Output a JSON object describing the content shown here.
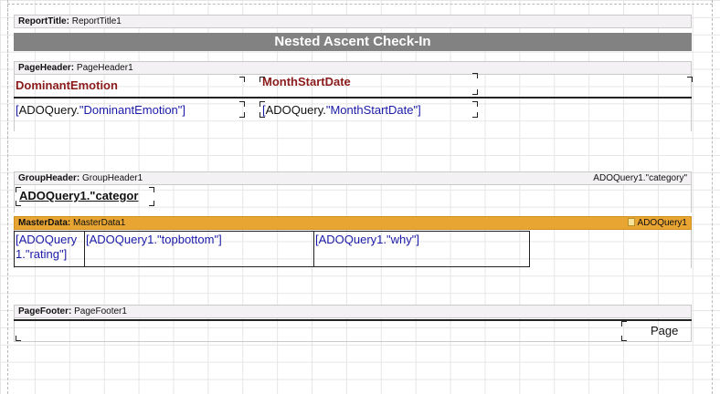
{
  "bands": {
    "report_title": {
      "kind": "ReportTitle:",
      "name": "ReportTitle1",
      "title": "Nested Ascent Check-In"
    },
    "page_header": {
      "kind": "PageHeader:",
      "name": "PageHeader1",
      "col1_label": "DominantEmotion",
      "col2_label": "MonthStartDate"
    },
    "page_header_fields": {
      "col1": {
        "query": "ADOQuery.",
        "field": "\"DominantEmotion\""
      },
      "col2": {
        "query": "ADOQuery.",
        "field": "\"MonthStartDate\""
      }
    },
    "group_header": {
      "kind": "GroupHeader:",
      "name": "GroupHeader1",
      "condition": "ADOQuery1.\"category\"",
      "field_text": "ADOQuery1.\"categor"
    },
    "master_data": {
      "kind": "MasterData:",
      "name": "MasterData1",
      "dataset": "ADOQuery1",
      "cells": [
        {
          "line1": "[ADOQuery",
          "line2": "1.\"rating\"]"
        },
        {
          "line1": "[ADOQuery1.\"topbottom\"]"
        },
        {
          "line1": "[ADOQuery1.\"why\"]"
        }
      ]
    },
    "page_footer": {
      "kind": "PageFooter:",
      "name": "PageFooter1",
      "page_text": "Page"
    }
  }
}
